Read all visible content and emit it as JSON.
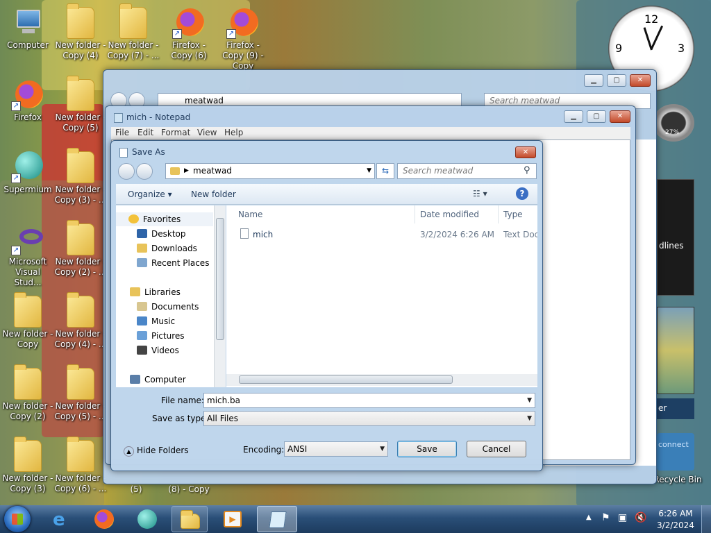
{
  "desktop": {
    "icons": [
      {
        "label": "Computer"
      },
      {
        "label": "New folder - Copy (4)"
      },
      {
        "label": "New folder - Copy (7) - ..."
      },
      {
        "label": "Firefox - Copy (6)"
      },
      {
        "label": "Firefox - Copy (9) - Copy"
      },
      {
        "label": "Firefox"
      },
      {
        "label": "New folder - Copy (5)"
      },
      {
        "label": "Supermium"
      },
      {
        "label": "New folder - Copy (3) - ..."
      },
      {
        "label": "Microsoft Visual Stud..."
      },
      {
        "label": "New folder - Copy (2) - ..."
      },
      {
        "label": "New folder - Copy"
      },
      {
        "label": "New folder - Copy (4) - ..."
      },
      {
        "label": "New folder - Copy (2)"
      },
      {
        "label": "New folder - Copy (5) - ..."
      },
      {
        "label": "New folder - Copy (3)"
      },
      {
        "label": "New folder - Copy (6) - ..."
      },
      {
        "label": "(5)"
      },
      {
        "label": "(8) - Copy"
      },
      {
        "label": "Recycle Bin"
      }
    ],
    "gadget_text": {
      "headlines": "dlines",
      "connect": "connect",
      "cpu": "27%",
      "er": "er"
    }
  },
  "explorer": {
    "path": "meatwad",
    "search_placeholder": "Search meatwad"
  },
  "notepad": {
    "title": "mich - Notepad",
    "menu": [
      "File",
      "Edit",
      "Format",
      "View",
      "Help"
    ]
  },
  "save_as": {
    "title": "Save As",
    "path": "meatwad",
    "search_placeholder": "Search meatwad",
    "organize": "Organize",
    "new_folder": "New folder",
    "tree": {
      "favorites": "Favorites",
      "desktop": "Desktop",
      "downloads": "Downloads",
      "recent": "Recent Places",
      "libraries": "Libraries",
      "documents": "Documents",
      "music": "Music",
      "pictures": "Pictures",
      "videos": "Videos",
      "computer": "Computer"
    },
    "columns": {
      "name": "Name",
      "date": "Date modified",
      "type": "Type"
    },
    "files": [
      {
        "name": "mich",
        "date": "3/2/2024 6:26 AM",
        "type": "Text Docu"
      }
    ],
    "file_name_label": "File name:",
    "file_name_value": "mich.ba",
    "save_type_label": "Save as type:",
    "save_type_value": "All Files",
    "hide_folders": "Hide Folders",
    "encoding_label": "Encoding:",
    "encoding_value": "ANSI",
    "save": "Save",
    "cancel": "Cancel"
  },
  "taskbar": {
    "time": "6:26 AM",
    "date": "3/2/2024"
  },
  "colors": {
    "taskbar": "#2a4f78",
    "accent": "#3a5e84",
    "close": "#c34a2a"
  }
}
